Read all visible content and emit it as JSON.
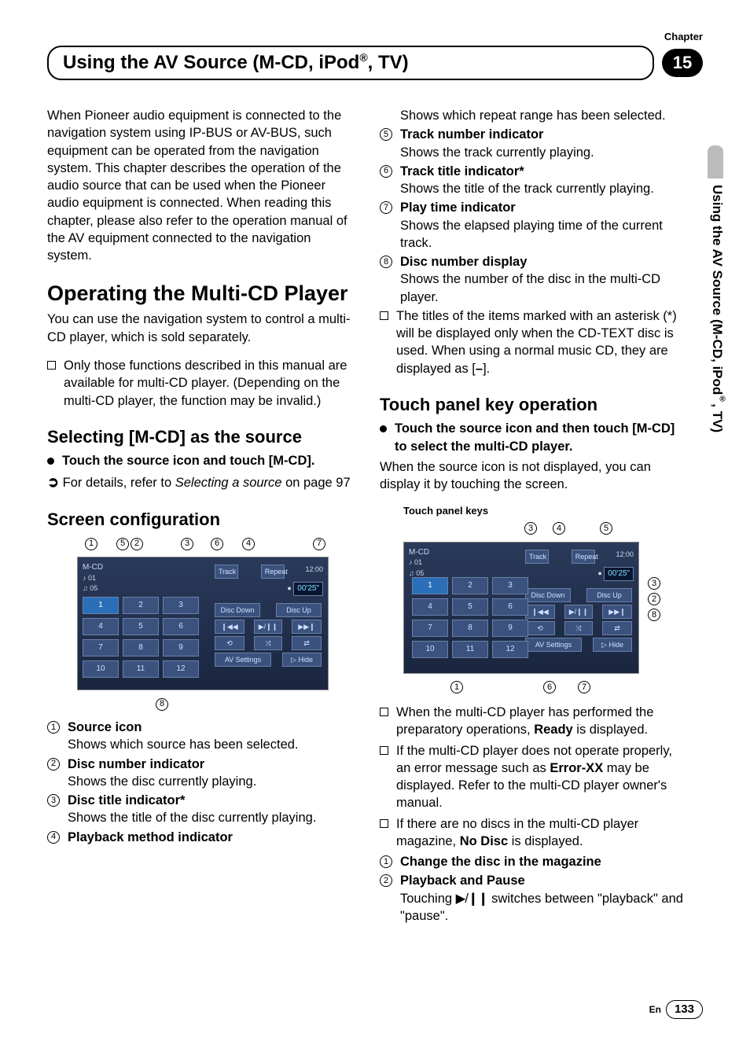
{
  "chapter_label": "Chapter",
  "chapter_number": "15",
  "header_title_pre": "Using the AV Source (M-CD, iPod",
  "header_title_sup": "®",
  "header_title_post": ", TV)",
  "side_tab_pre": "Using the AV Source (M-CD, iPod",
  "side_tab_sup": "®",
  "side_tab_post": ", TV)",
  "intro_para": "When Pioneer audio equipment is connected to the navigation system using IP-BUS or AV-BUS, such equipment can be operated from the navigation system. This chapter describes the operation of the audio source that can be used when the Pioneer audio equipment is connected. When reading this chapter, please also refer to the operation manual of the AV equipment connected to the navigation system.",
  "h1_operating": "Operating the Multi-CD Player",
  "operating_para": "You can use the navigation system to control a multi-CD player, which is sold separately.",
  "operating_bullet": "Only those functions described in this manual are available for multi-CD player. (Depending on the multi-CD player, the function may be invalid.)",
  "h2_selecting": "Selecting [M-CD] as the source",
  "selecting_step_pre": "Touch the source icon and touch ",
  "selecting_step_mcd": "[M-CD]",
  "selecting_step_post": ".",
  "selecting_ref_arrow": "➲",
  "selecting_ref_pre": " For details, refer to ",
  "selecting_ref_it": "Selecting a source",
  "selecting_ref_post": " on page 97",
  "h2_screenconf": "Screen configuration",
  "sc_callouts_top": [
    "1",
    "5",
    "2",
    "3",
    "6",
    "4",
    "7"
  ],
  "sc_callouts_bottom": [
    "8"
  ],
  "sc_items": [
    {
      "n": "1",
      "label": "Source icon",
      "desc": "Shows which source has been selected."
    },
    {
      "n": "2",
      "label": "Disc number indicator",
      "desc": "Shows the disc currently playing."
    },
    {
      "n": "3",
      "label": "Disc title indicator*",
      "desc": "Shows the title of the disc currently playing."
    },
    {
      "n": "4",
      "label": "Playback method indicator",
      "desc": ""
    }
  ],
  "col2_top_line": "Shows which repeat range has been selected.",
  "col2_items": [
    {
      "n": "5",
      "label": "Track number indicator",
      "desc": "Shows the track currently playing."
    },
    {
      "n": "6",
      "label": "Track title indicator*",
      "desc": "Shows the title of the track currently playing."
    },
    {
      "n": "7",
      "label": "Play time indicator",
      "desc": "Shows the elapsed playing time of the current track."
    },
    {
      "n": "8",
      "label": "Disc number display",
      "desc": "Shows the number of the disc in the multi-CD player."
    }
  ],
  "col2_note_pre": "The titles of the items marked with an asterisk (*) will be displayed only when the CD-TEXT disc is used. When using a normal music CD, they are displayed as [",
  "col2_note_dash": "–",
  "col2_note_post": "].",
  "h2_touchpanel": "Touch panel key operation",
  "tp_step_pre": "Touch the source icon and then touch ",
  "tp_step_mcd": "[M-CD]",
  "tp_step_post": " to select the multi-CD player.",
  "tp_para": "When the source icon is not displayed, you can display it by touching the screen.",
  "tpk_label": "Touch panel keys",
  "tp_callouts_top": [
    "3",
    "4",
    "5"
  ],
  "tp_callouts_right": [
    "3",
    "2",
    "8"
  ],
  "tp_callouts_bottom": [
    "1",
    "6",
    "7"
  ],
  "tp_bullets": [
    {
      "pre": "When the multi-CD player has performed the preparatory operations, ",
      "bold": "Ready",
      "post": " is displayed."
    },
    {
      "pre": "If the multi-CD player does not operate properly, an error message such as ",
      "bold": "Error-XX",
      "post": " may be displayed. Refer to the multi-CD player owner's manual."
    },
    {
      "pre": "If there are no discs in the multi-CD player magazine, ",
      "bold": "No Disc",
      "post": " is displayed."
    }
  ],
  "tp_numbered": [
    {
      "n": "1",
      "label": "Change the disc in the magazine",
      "desc": ""
    },
    {
      "n": "2",
      "label": "Playback and Pause",
      "desc_pre": "Touching ",
      "icon": "▶/❙❙",
      "desc_post": " switches between \"playback\" and \"pause\"."
    }
  ],
  "screenshot": {
    "source": "M-CD",
    "disc_no": "01",
    "track_no": "05",
    "top_right_labels": [
      "Track",
      "Repeat"
    ],
    "clock": "12:00",
    "time": "00'25\"",
    "disc_down": "Disc Down",
    "disc_up": "Disc Up",
    "av_settings": "AV Settings",
    "hide": "Hide",
    "grid": [
      "1",
      "2",
      "3",
      "4",
      "5",
      "6",
      "7",
      "8",
      "9",
      "10",
      "11",
      "12"
    ]
  },
  "footer_en": "En",
  "footer_page": "133"
}
